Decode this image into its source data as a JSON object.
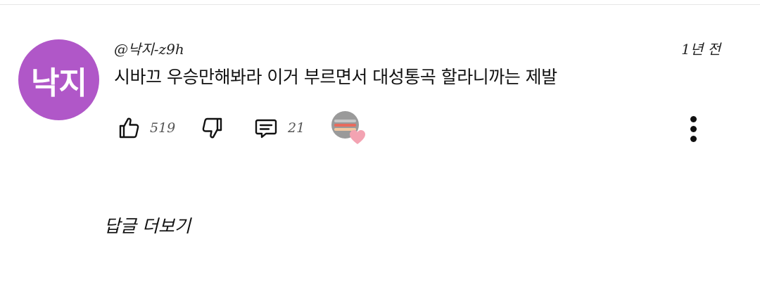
{
  "comment": {
    "avatar_text": "낙지",
    "avatar_color": "#b057c8",
    "handle": "@낙지-z9h",
    "time": "1년 전",
    "text": "시바끄 우승만해봐라 이거 부르면서 대성통곡 할라니까는 제발"
  },
  "actions": {
    "like_count": "519",
    "reply_count": "21",
    "like_icon": "thumbs-up-icon",
    "dislike_icon": "thumbs-down-icon",
    "reply_icon": "comment-icon",
    "creator_heart_color": "#f3a3b2",
    "more_icon": "more-vertical-icon"
  },
  "replies": {
    "label": "답글 더보기"
  }
}
